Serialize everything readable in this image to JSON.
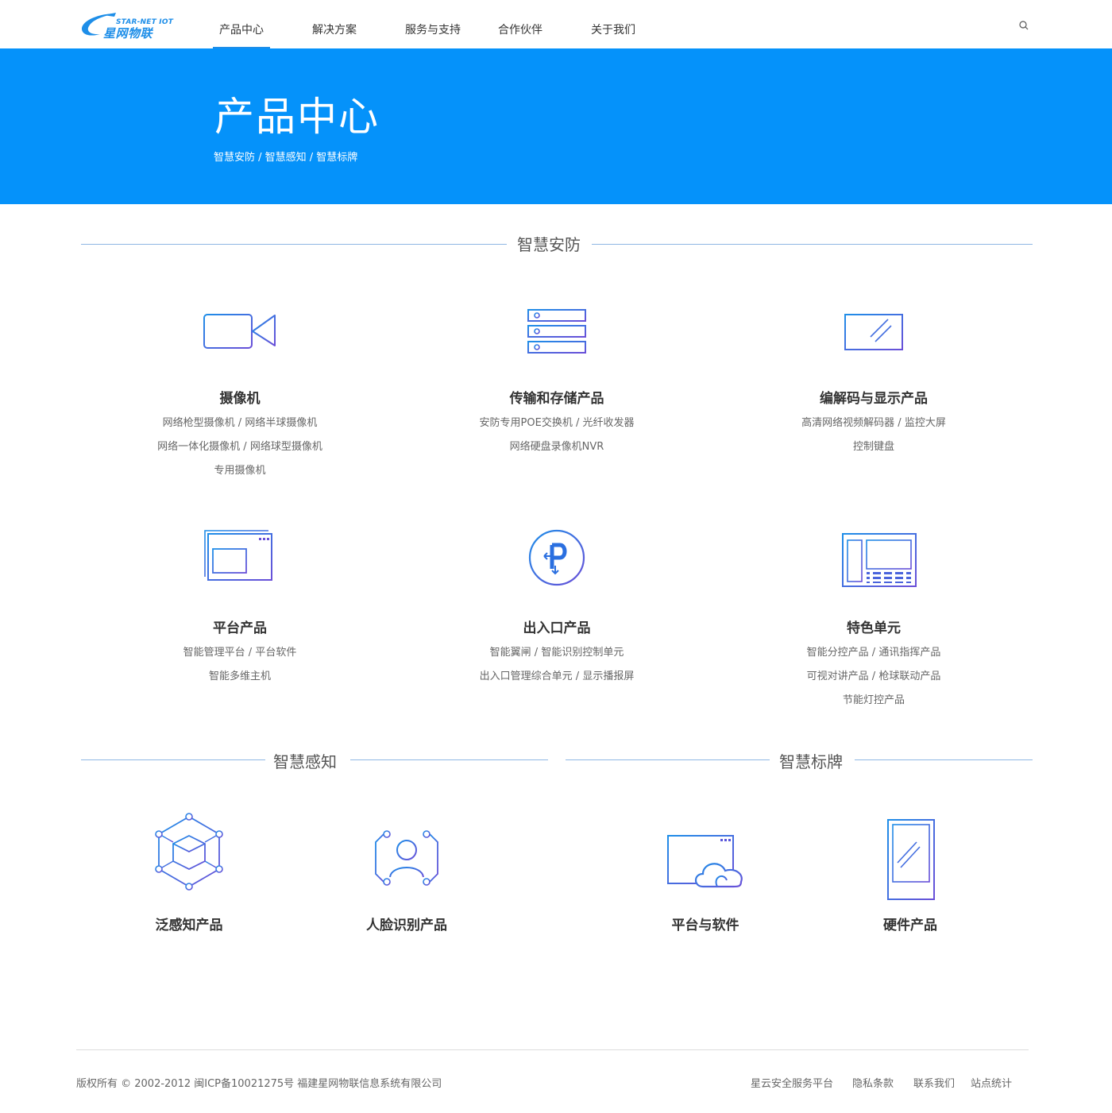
{
  "header": {
    "logo": {
      "tagline": "STAR-NET IOT",
      "name": "星网物联"
    },
    "nav": [
      "产品中心",
      "解决方案",
      "服务与支持",
      "合作伙伴",
      "关于我们"
    ],
    "active_nav": "产品中心",
    "search_icon": "search-icon"
  },
  "banner": {
    "title": "产品中心",
    "subtitle": "智慧安防 / 智慧感知 / 智慧标牌"
  },
  "sections": {
    "security": {
      "title": "智慧安防",
      "products": [
        {
          "icon": "video-camera-icon",
          "title": "摄像机",
          "lines": [
            "网络枪型摄像机 / 网络半球摄像机",
            "网络一体化摄像机 / 网络球型摄像机",
            "专用摄像机"
          ]
        },
        {
          "icon": "server-rack-icon",
          "title": "传输和存储产品",
          "lines": [
            "安防专用POE交换机 / 光纤收发器",
            "网络硬盘录像机NVR"
          ]
        },
        {
          "icon": "monitor-icon",
          "title": "编解码与显示产品",
          "lines": [
            "高清网络视频解码器 / 监控大屏",
            "控制键盘"
          ]
        },
        {
          "icon": "platform-window-icon",
          "title": "平台产品",
          "lines": [
            "智能管理平台  / 平台软件",
            "智能多维主机"
          ]
        },
        {
          "icon": "parking-icon",
          "title": "出入口产品",
          "lines": [
            "智能翼闸 / 智能识别控制单元",
            "出入口管理综合单元 / 显示播报屏"
          ]
        },
        {
          "icon": "control-panel-icon",
          "title": "特色单元",
          "lines": [
            "智能分控产品 / 通讯指挥产品",
            "可视对讲产品 / 枪球联动产品",
            "节能灯控产品"
          ]
        }
      ]
    },
    "perception": {
      "title": "智慧感知",
      "products": [
        {
          "icon": "hexagon-cube-icon",
          "title": "泛感知产品"
        },
        {
          "icon": "face-recognition-icon",
          "title": "人脸识别产品"
        }
      ]
    },
    "signage": {
      "title": "智慧标牌",
      "products": [
        {
          "icon": "cloud-window-icon",
          "title": "平台与软件"
        },
        {
          "icon": "signage-display-icon",
          "title": "硬件产品"
        }
      ]
    }
  },
  "footer": {
    "copyright": "版权所有 © 2002-2012 闽ICP备10021275号 福建星网物联信息系统有限公司",
    "links": [
      "星云安全服务平台",
      "隐私条款",
      "联系我们",
      "站点统计"
    ]
  },
  "colors": {
    "brand": "#0592fa",
    "accent": "#1e8ee8",
    "icon_gradient_start": "#1e8ee8",
    "icon_gradient_end": "#6a4fd8"
  }
}
